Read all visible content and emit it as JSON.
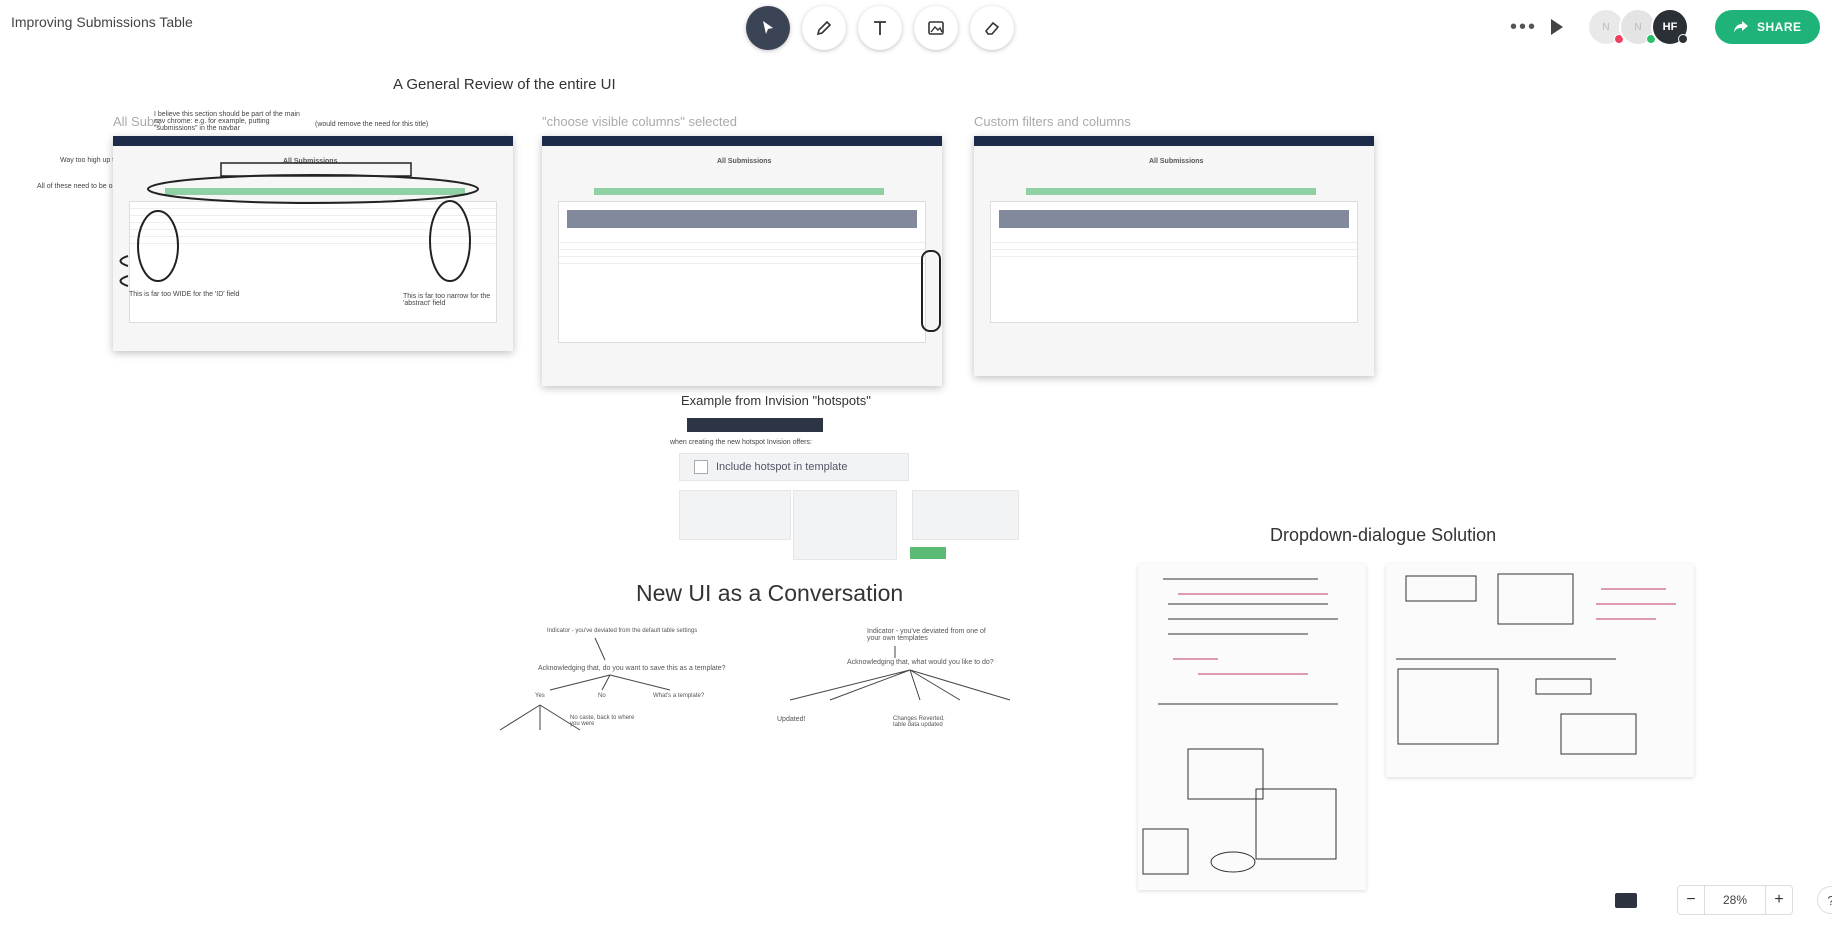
{
  "doc": {
    "title": "Improving Submissions Table"
  },
  "toolbar": {
    "tools": [
      {
        "name": "select-tool",
        "icon": "cursor-icon"
      },
      {
        "name": "pen-tool",
        "icon": "pencil-icon"
      },
      {
        "name": "text-tool",
        "icon": "text-icon"
      },
      {
        "name": "image-tool",
        "icon": "image-icon"
      },
      {
        "name": "eraser-tool",
        "icon": "eraser-icon"
      }
    ]
  },
  "header": {
    "more": "•••",
    "avatars": [
      {
        "initials": "N"
      },
      {
        "initials": "N"
      },
      {
        "initials": "HF"
      }
    ],
    "share_label": "SHARE"
  },
  "canvas": {
    "general_review": "A General Review of the entire UI",
    "all_subs": "All Subs",
    "choose_visible": "\"choose visible columns\" selected",
    "custom_filters": "Custom filters and columns",
    "invision_example": "Example from Invision \"hotspots\"",
    "invision_note": "when creating the new hotspot Invision offers:",
    "include_hotspot": "Include hotspot in template",
    "new_ui": "New UI as a Conversation",
    "dropdown_solution": "Dropdown-dialogue Solution",
    "annotation_note1": "I believe this section should be part of the main nav chrome: e.g. for example, putting \"submissions\" in the navbar",
    "annotation_note2": "(would remove the need for this title)",
    "annotation_note3": "Way too high up the hierarchy!",
    "annotation_note4": "All of these need to be organised",
    "annotation_note5": "This is far too WIDE for the 'ID' field",
    "annotation_note6": "This is far too narrow for the 'abstract' field",
    "shot_title": "All Submissions",
    "conv_left_q": "Acknowledging that, do you want to save this as a template?",
    "conv_left_indicator": "Indicator - you've deviated from the default table settings",
    "conv_yes": "Yes",
    "conv_no": "No",
    "conv_whats": "What's a template?",
    "conv_nocaste": "No caste, back to where you were",
    "conv_right_indicator": "Indicator - you've deviated from one of your own templates",
    "conv_right_q": "Acknowledging that, what would you like to do?",
    "conv_updated": "Updated!",
    "conv_reverted": "Changes Reverted, table data updated"
  },
  "zoom": {
    "value": "28%",
    "minus": "−",
    "plus": "+"
  },
  "help": {
    "label": "?"
  },
  "colors": {
    "accent": "#1fb37a",
    "tool_active": "#3b4455",
    "nav_dark": "#1e2a4a"
  }
}
